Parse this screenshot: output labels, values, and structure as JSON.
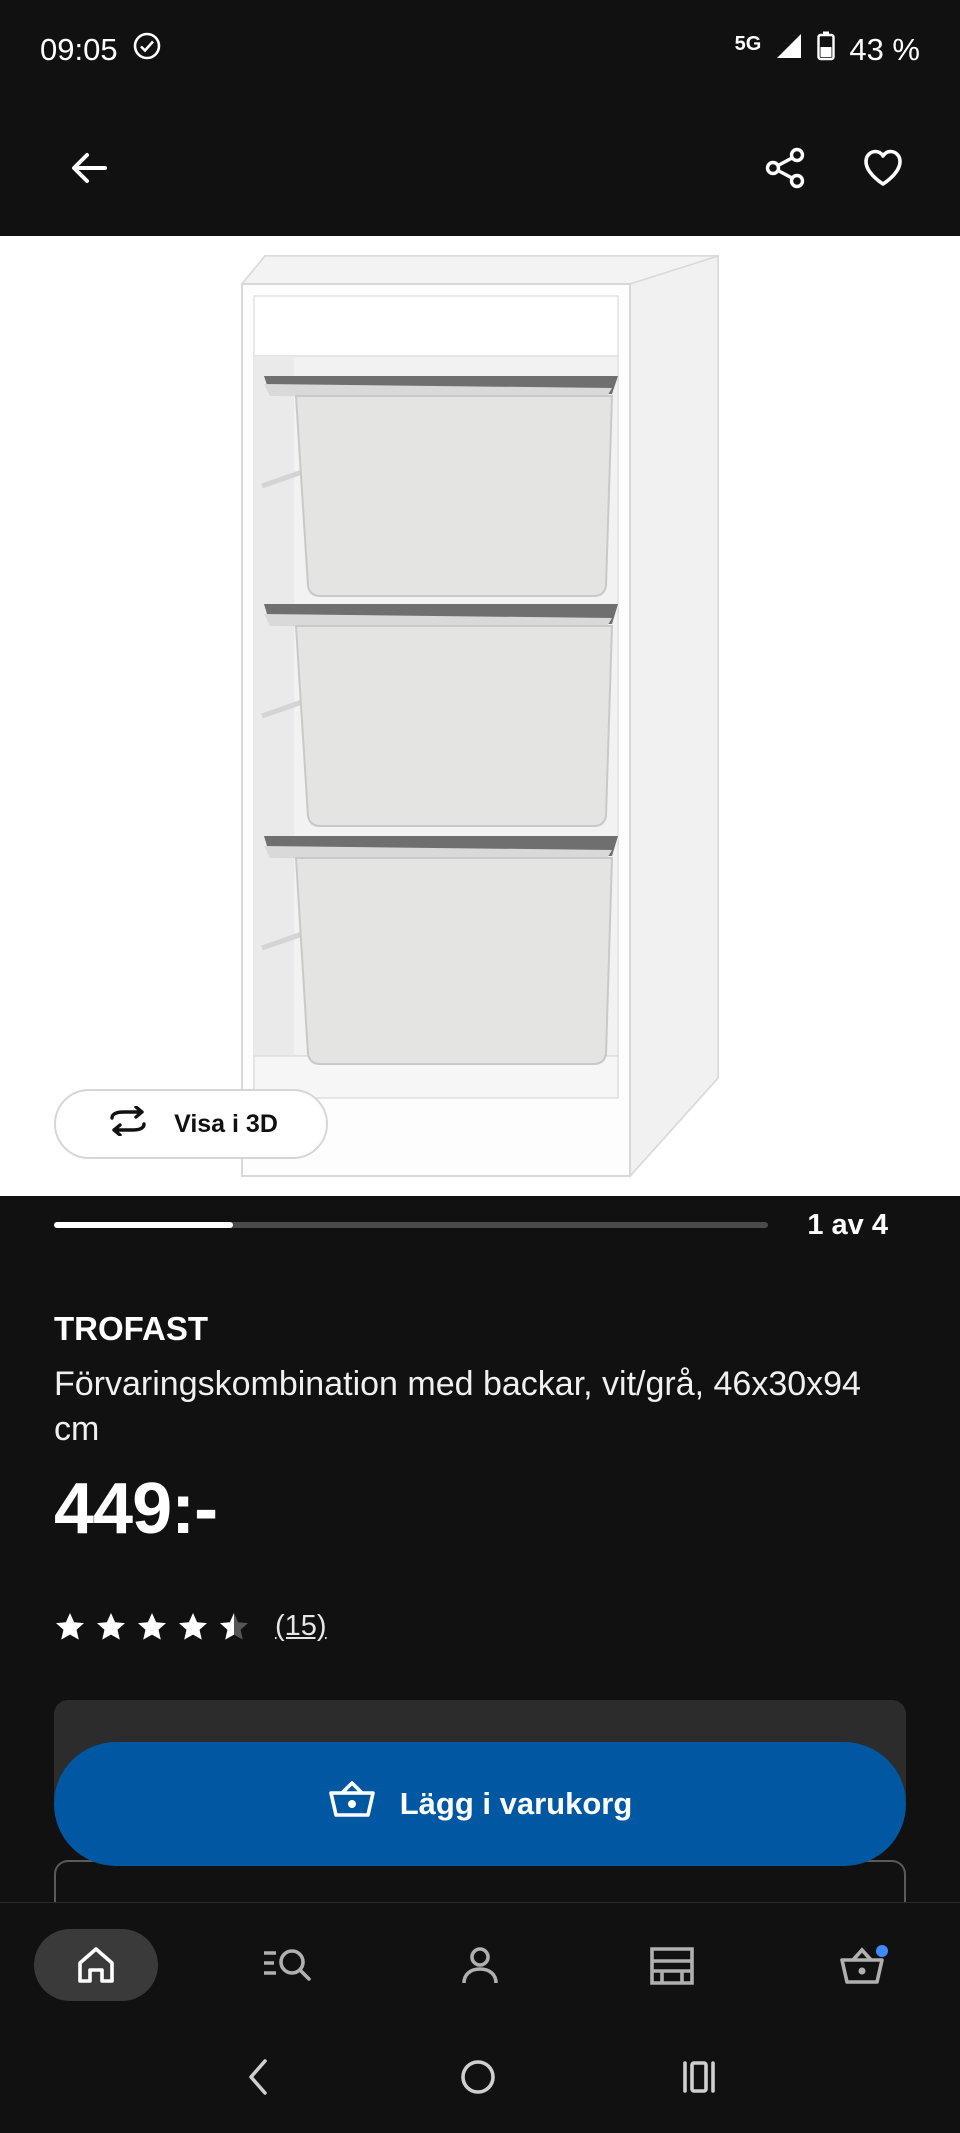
{
  "status_bar": {
    "time": "09:05",
    "network": "5G",
    "battery": "43 %"
  },
  "gallery": {
    "view_3d_label": "Visa i 3D",
    "counter": "1 av 4",
    "progress": 0.25
  },
  "product": {
    "name": "TROFAST",
    "description": "Förvaringskombination med backar, vit/grå, 46x30x94 cm",
    "price": "449:-",
    "rating": 4.5,
    "review_count": "(15)"
  },
  "cart": {
    "add_label": "Lägg i varukorg"
  },
  "bottom_nav": {
    "items": [
      "home-icon",
      "search-icon",
      "profile-icon",
      "store-icon",
      "cart-icon"
    ],
    "active": "home-icon"
  },
  "colors": {
    "accent": "#0058a3",
    "background": "#111111",
    "badge": "#3d8bfd"
  }
}
